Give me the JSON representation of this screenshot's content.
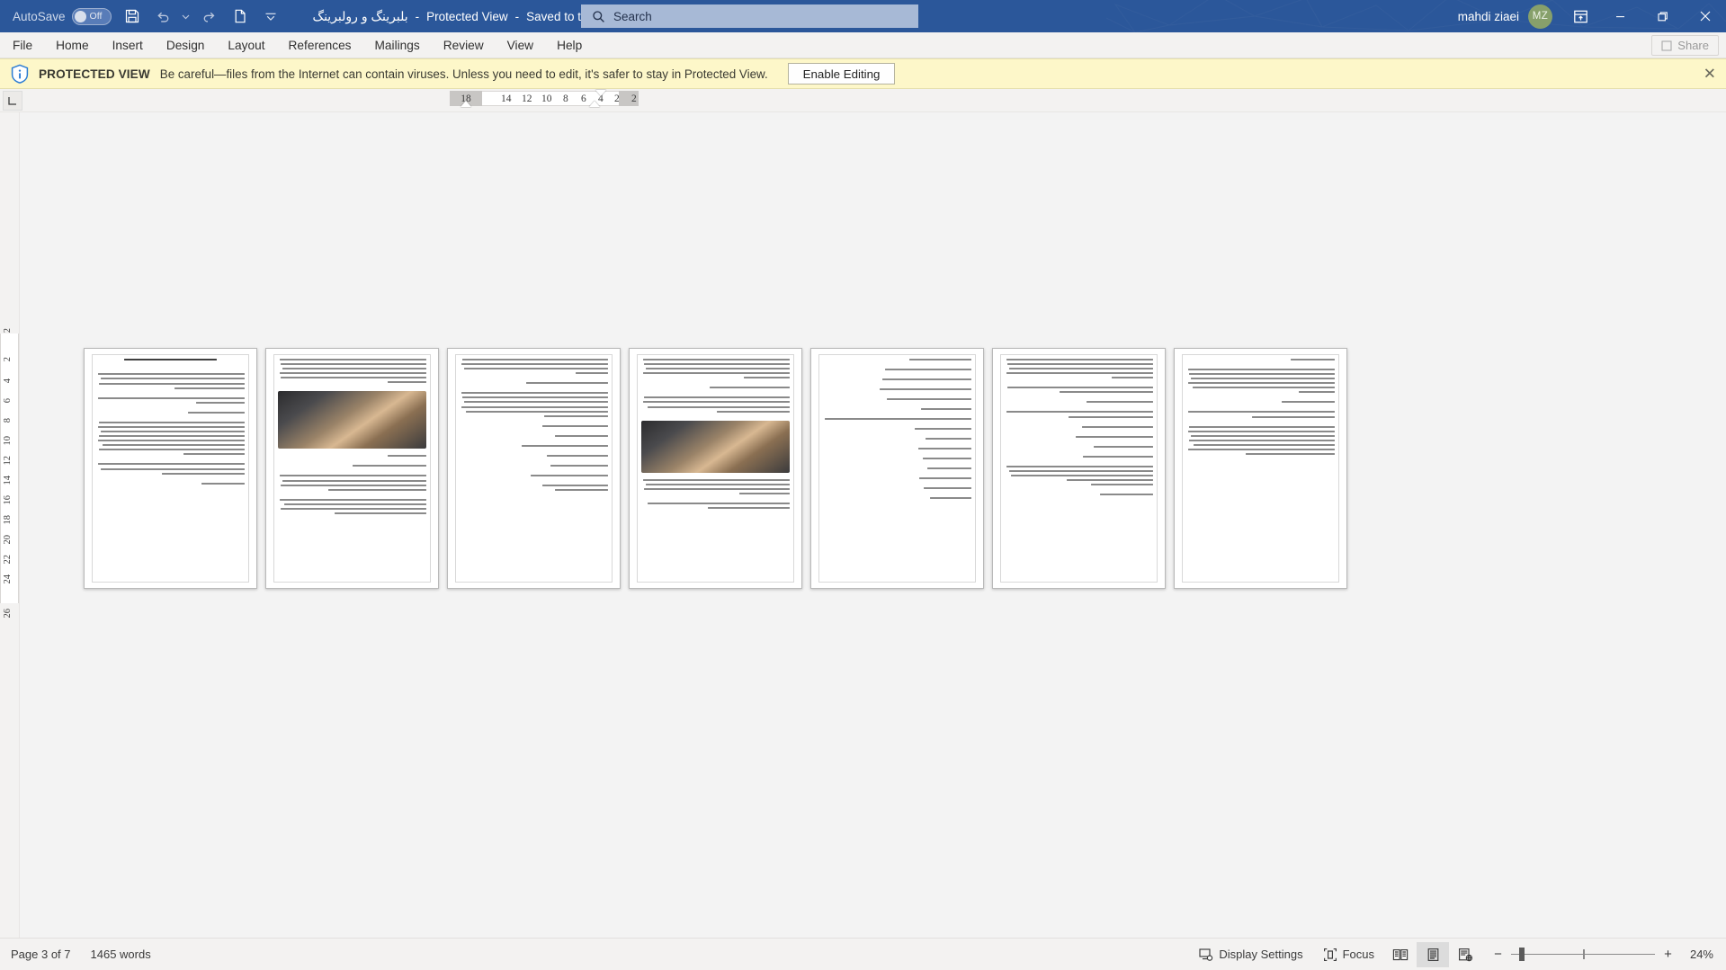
{
  "titlebar": {
    "autosave_label": "AutoSave",
    "autosave_state": "Off",
    "quick_access": [
      {
        "name": "save-icon",
        "tooltip": "Save"
      },
      {
        "name": "undo-icon",
        "tooltip": "Undo"
      },
      {
        "name": "undo-dropdown-icon",
        "tooltip": "Undo options"
      },
      {
        "name": "redo-icon",
        "tooltip": "Redo"
      },
      {
        "name": "new-document-icon",
        "tooltip": "New"
      },
      {
        "name": "customize-quick-access-icon",
        "tooltip": "Customize Quick Access Toolbar"
      }
    ],
    "document_name": "بلبرینگ و رولبرینگ",
    "sep1": "-",
    "protected_view": "Protected View",
    "sep2": "-",
    "saved_location": "Saved to this PC",
    "search_placeholder": "Search",
    "account_name": "mahdi ziaei",
    "account_initials": "MZ",
    "ribbon_display_options": "ribbon-display-options-icon",
    "minimize": "minimize-icon",
    "restore": "restore-icon",
    "close": "close-icon"
  },
  "ribbon": {
    "tabs": [
      {
        "label": "File"
      },
      {
        "label": "Home"
      },
      {
        "label": "Insert"
      },
      {
        "label": "Design"
      },
      {
        "label": "Layout"
      },
      {
        "label": "References"
      },
      {
        "label": "Mailings"
      },
      {
        "label": "Review"
      },
      {
        "label": "View"
      },
      {
        "label": "Help"
      }
    ],
    "share_label": "Share"
  },
  "protected_view": {
    "title": "PROTECTED VIEW",
    "message": "Be careful—files from the Internet can contain viruses. Unless you need to edit, it's safer to stay in Protected View.",
    "enable_label": "Enable Editing",
    "close_label": "✕"
  },
  "ruler": {
    "tab_selector": "tab-stop-selector",
    "h_numbers": [
      "18",
      "14",
      "12",
      "10",
      "8",
      "6",
      "4",
      "2",
      "2"
    ],
    "v_numbers": [
      "2",
      "2",
      "4",
      "6",
      "8",
      "10",
      "12",
      "14",
      "16",
      "18",
      "20",
      "22",
      "24",
      "26"
    ]
  },
  "document": {
    "pages": [
      {
        "index": 1,
        "heading": true,
        "has_image": false
      },
      {
        "index": 2,
        "heading": false,
        "has_image": true
      },
      {
        "index": 3,
        "heading": false,
        "has_image": false
      },
      {
        "index": 4,
        "heading": false,
        "has_image": true
      },
      {
        "index": 5,
        "heading": false,
        "has_image": false
      },
      {
        "index": 6,
        "heading": false,
        "has_image": false
      },
      {
        "index": 7,
        "heading": false,
        "has_image": false
      }
    ]
  },
  "status": {
    "page_info": "Page 3 of 7",
    "word_count": "1465 words",
    "display_settings": "Display Settings",
    "focus": "Focus",
    "views": [
      {
        "name": "read-mode-view-icon",
        "selected": false
      },
      {
        "name": "print-layout-view-icon",
        "selected": true
      },
      {
        "name": "web-layout-view-icon",
        "selected": false
      }
    ],
    "zoom_out": "−",
    "zoom_in": "+",
    "zoom_level": "24%"
  },
  "colors": {
    "titlebar": "#2b579a",
    "ribbon": "#f3f2f1",
    "banner": "#fdf7c9",
    "accent": "#2b579a",
    "avatar": "#87a06b",
    "canvas": "#f3f3f3"
  }
}
